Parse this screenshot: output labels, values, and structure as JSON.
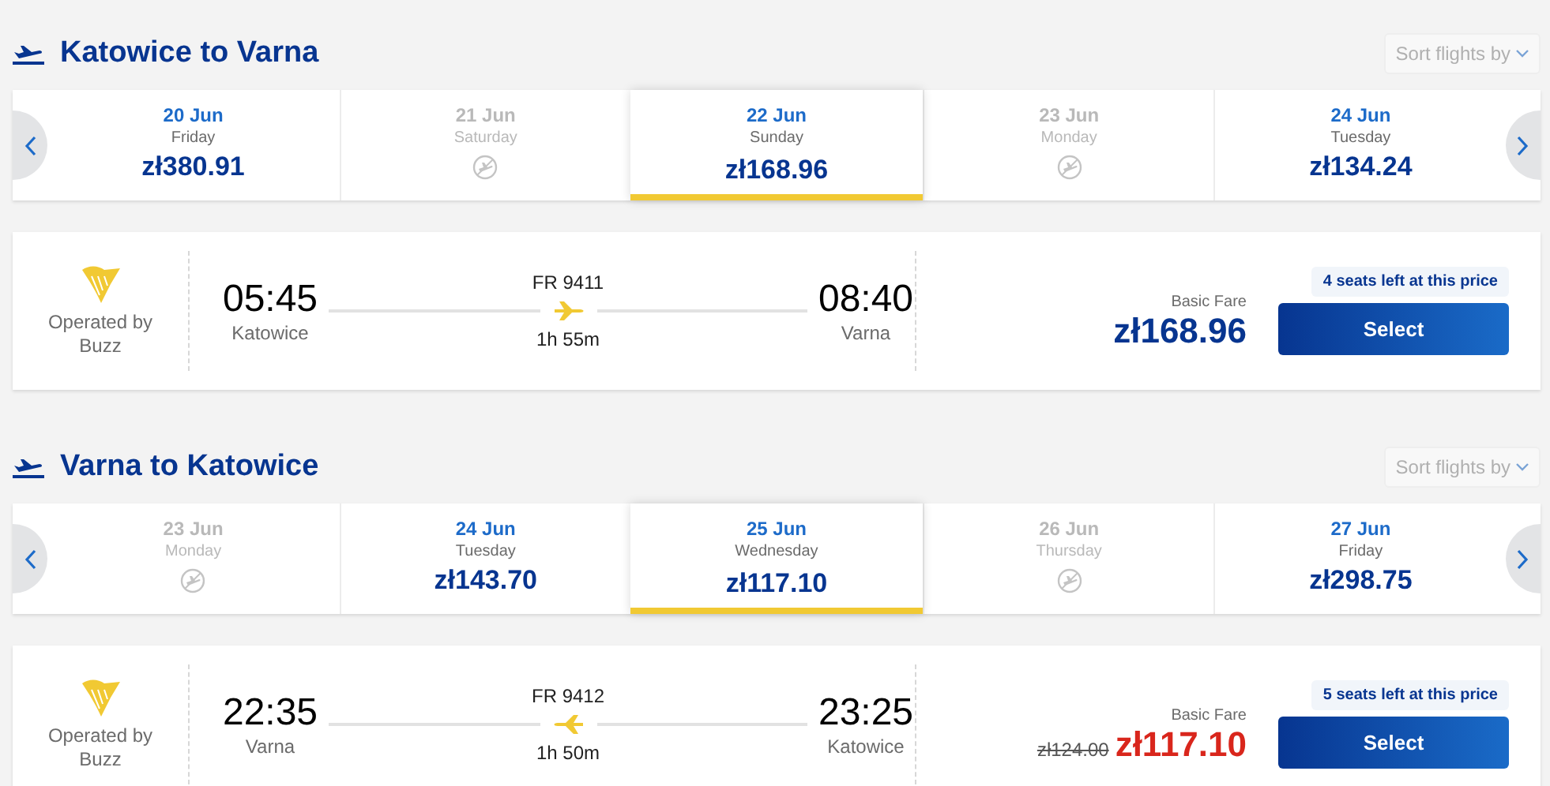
{
  "sections": [
    {
      "title": "Katowice to Varna",
      "sort_label": "Sort flights by",
      "dates": [
        {
          "date": "20 Jun",
          "day": "Friday",
          "price": "zł380.91",
          "available": true,
          "selected": false
        },
        {
          "date": "21 Jun",
          "day": "Saturday",
          "available": false,
          "selected": false
        },
        {
          "date": "22 Jun",
          "day": "Sunday",
          "price": "zł168.96",
          "available": true,
          "selected": true
        },
        {
          "date": "23 Jun",
          "day": "Monday",
          "available": false,
          "selected": false
        },
        {
          "date": "24 Jun",
          "day": "Tuesday",
          "price": "zł134.24",
          "available": true,
          "selected": false
        }
      ],
      "flight": {
        "operator": "Operated by Buzz",
        "flight_number": "FR 9411",
        "inbound": false,
        "depart_time": "05:45",
        "depart_city": "Katowice",
        "duration": "1h 55m",
        "arrive_time": "08:40",
        "arrive_city": "Varna",
        "fare_label": "Basic Fare",
        "price": "zł168.96",
        "discounted": false,
        "seats": "4 seats left at this price",
        "button": "Select"
      }
    },
    {
      "title": "Varna to Katowice",
      "sort_label": "Sort flights by",
      "dates": [
        {
          "date": "23 Jun",
          "day": "Monday",
          "available": false,
          "selected": false
        },
        {
          "date": "24 Jun",
          "day": "Tuesday",
          "price": "zł143.70",
          "available": true,
          "selected": false
        },
        {
          "date": "25 Jun",
          "day": "Wednesday",
          "price": "zł117.10",
          "available": true,
          "selected": true
        },
        {
          "date": "26 Jun",
          "day": "Thursday",
          "available": false,
          "selected": false
        },
        {
          "date": "27 Jun",
          "day": "Friday",
          "price": "zł298.75",
          "available": true,
          "selected": false
        }
      ],
      "flight": {
        "operator": "Operated by Buzz",
        "flight_number": "FR 9412",
        "inbound": true,
        "depart_time": "22:35",
        "depart_city": "Varna",
        "duration": "1h 50m",
        "arrive_time": "23:25",
        "arrive_city": "Katowice",
        "fare_label": "Basic Fare",
        "old_price": "zł124.00",
        "price": "zł117.10",
        "discounted": true,
        "seats": "5 seats left at this price",
        "button": "Select"
      }
    }
  ]
}
